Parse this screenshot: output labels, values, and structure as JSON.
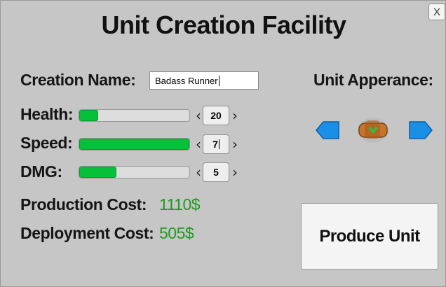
{
  "window": {
    "title": "Unit Creation Facility",
    "close_label": "X"
  },
  "creation_name": {
    "label": "Creation Name:",
    "value": "Badass Runner"
  },
  "unit_appearance": {
    "label": "Unit Apperance:",
    "prev_icon": "arrow-left-icon",
    "next_icon": "arrow-right-icon",
    "preview_icon": "unit-preview-icon"
  },
  "stats": [
    {
      "label": "Health:",
      "value": "20",
      "fill_fraction": 0.17
    },
    {
      "label": "Speed:",
      "value": "7",
      "fill_fraction": 1.0
    },
    {
      "label": "DMG:",
      "value": "5",
      "fill_fraction": 0.34
    }
  ],
  "costs": {
    "production": {
      "label": "Production Cost:",
      "value": "1110$"
    },
    "deployment": {
      "label": "Deployment Cost:",
      "value": "505$"
    }
  },
  "produce_button": {
    "label": "Produce Unit"
  },
  "colors": {
    "accent_green": "#06c03a",
    "cost_green": "#1e9a1e",
    "nav_blue": "#1a8fe6",
    "background": "#c6c6c6"
  }
}
